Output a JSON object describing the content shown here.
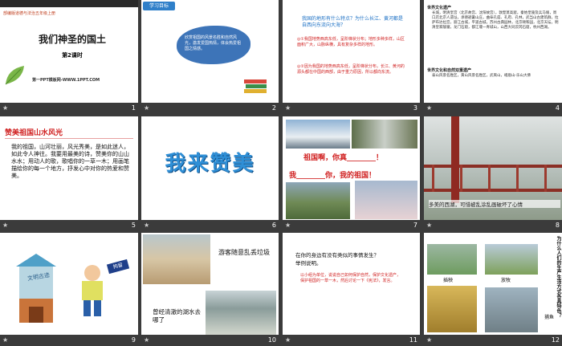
{
  "slides": [
    {
      "num": "1",
      "publisher": "部编版道德与法治五年级上册",
      "title": "我们神圣的国土",
      "subtitle": "第2课时",
      "site": "第一PPT模板网-WWW.1PPT.COM"
    },
    {
      "num": "2",
      "label": "学习目标",
      "text": "欣赏祖国的风景名胜和自然风光，激发爱国热情，体会热爱祖国之情感。"
    },
    {
      "num": "3",
      "question": "我国的地形有什么特点？为什么长江、黄河都是自西向东流向大海？",
      "answer1": "◎①我国地势西高东低，呈阶梯状分布；地形多种多样，山区面积广大，山脉纵横，具有复杂多样的地形。",
      "answer2": "◎②因为我国的地势西高东低，呈阶梯状分布，长江、黄河的源头都在中国的西部，由于重力原因，所以都向东流。"
    },
    {
      "num": "4",
      "h1": "世界文化遗产",
      "p1": "长城，明清皇宫（北京故宫、沈阳故宫），敦煌莫高窟，秦始皇陵及兵马俑，周口店北京人遗址，承德避暑山庄，曲阜孔庙、孔府、孔林，武当山古建筑群，拉萨布达拉宫，丽江古城，平遥古城，苏州古典园林，北京颐和园，北京天坛，明清皇家陵寝，龙门石窟，都江堰一青城山，山西大同云冈石窟，杭州西湖。",
      "h2": "世界文化和自然双重遗产",
      "p2": "泰山风景名胜区，黄山风景名胜区，武夷山，峨眉山-乐山大佛"
    },
    {
      "num": "5",
      "heading": "赞美祖国山水风光",
      "body": "我的祖国，山河壮丽，风光秀美，是如此迷人，如此令人神往。我要用最美的诗，赞美你的山山水水；用动人的歌，歌唱你的一草一木；用画笔描绘你的每一个地方，抒发心中对你的热爱和赞美。"
    },
    {
      "num": "6",
      "big": "我来赞美"
    },
    {
      "num": "7",
      "line1": "祖国啊，你真________！",
      "line2": "我________你，我的祖国！"
    },
    {
      "num": "8",
      "caption": "多美的西湖，可惜被乱涂乱画破坏了心情"
    },
    {
      "num": "9",
      "wall": "文明古迹",
      "sign": "拘留"
    },
    {
      "num": "10",
      "top": "游客随意乱丢垃圾",
      "bottom": "曾经清澈的湖水去哪了"
    },
    {
      "num": "11",
      "q1": "在你的身边有没有类似的事情发生？",
      "q2": "举例说明。",
      "a": "以小组为单位，说说自己如何保护自然，保护文化遗产，保护祖国的一草一木，然后讨论一下《宪法》，发言。"
    },
    {
      "num": "12",
      "vert": "为什么人们的生产生活方式各具特色？",
      "cap1": "插秧",
      "cap2": "放牧",
      "cap3": "捕鱼"
    }
  ],
  "colors": {
    "accent_red": "#d01f1f",
    "accent_blue": "#1a6fc4",
    "bg": "#3b3b3b"
  }
}
